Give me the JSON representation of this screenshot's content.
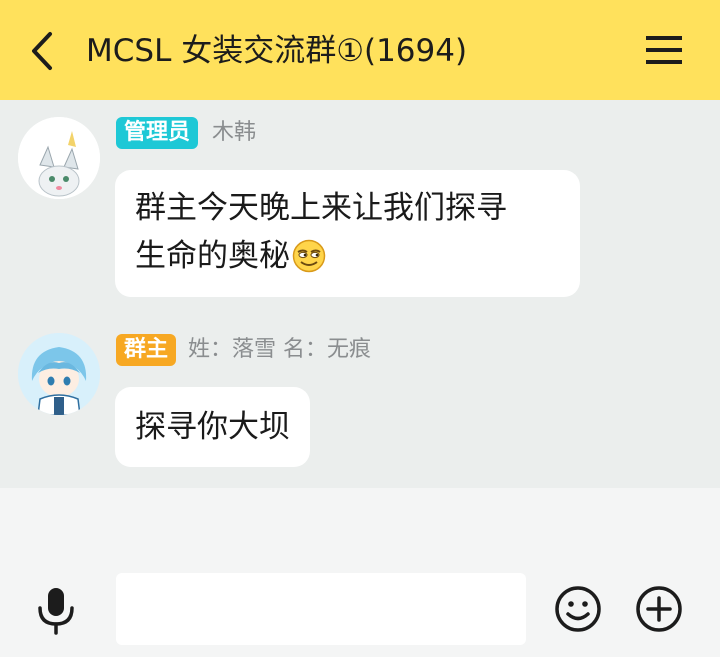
{
  "header": {
    "title": "MCSL 女装交流群①(1694)",
    "back_icon": "chevron-left-icon",
    "menu_icon": "hamburger-menu-icon",
    "background": "#ffe15c"
  },
  "messages": [
    {
      "role_badge": "管理员",
      "role_color": "#1ec8d6",
      "sender": "木韩",
      "text": "群主今天晚上来让我们探寻生命的奥秘",
      "text_lines": [
        "群主今天晚上来让我们探寻",
        "生命的奥秘"
      ],
      "emoji": "smirk-emoji"
    },
    {
      "role_badge": "群主",
      "role_color": "#f7a823",
      "sender": "姓：落雪 名：无痕",
      "text": "探寻你大坝"
    }
  ],
  "input_bar": {
    "message_value": "",
    "mic_icon": "microphone-icon",
    "emoji_icon": "smiley-icon",
    "plus_icon": "plus-circle-icon"
  }
}
